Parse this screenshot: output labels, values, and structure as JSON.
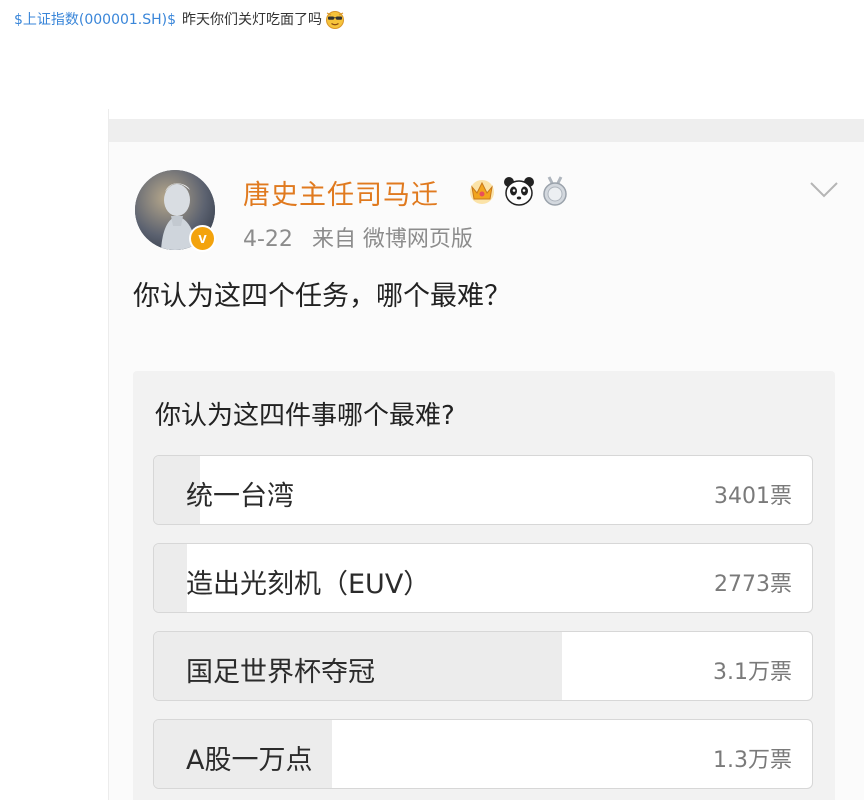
{
  "post": {
    "stock_tag": "$上证指数(000001.SH)$",
    "text": "昨天你们关灯吃面了吗",
    "emoji": "cool-face-emoji"
  },
  "weibo": {
    "user_name": "唐史主任司马迁",
    "verified_mark": "v",
    "badges": [
      "crown-badge-icon",
      "panda-badge-icon",
      "silver-medal-badge-icon"
    ],
    "date": "4-22",
    "source": "来自 微博网页版",
    "content": "你认为这四个任务，哪个最难？"
  },
  "poll": {
    "title": "你认为这四件事哪个最难?",
    "options": [
      {
        "label": "统一台湾",
        "count": "3401票",
        "share": 0.07
      },
      {
        "label": "造出光刻机（EUV）",
        "count": "2773票",
        "share": 0.05
      },
      {
        "label": "国足世界杯夺冠",
        "count": "3.1万票",
        "share": 0.62
      },
      {
        "label": "A股一万点",
        "count": "1.3万票",
        "share": 0.27
      }
    ]
  },
  "colors": {
    "link": "#3a86d9",
    "user_name": "#e07a1f",
    "verified": "#f3a30d",
    "poll_fill": "#ececec"
  }
}
